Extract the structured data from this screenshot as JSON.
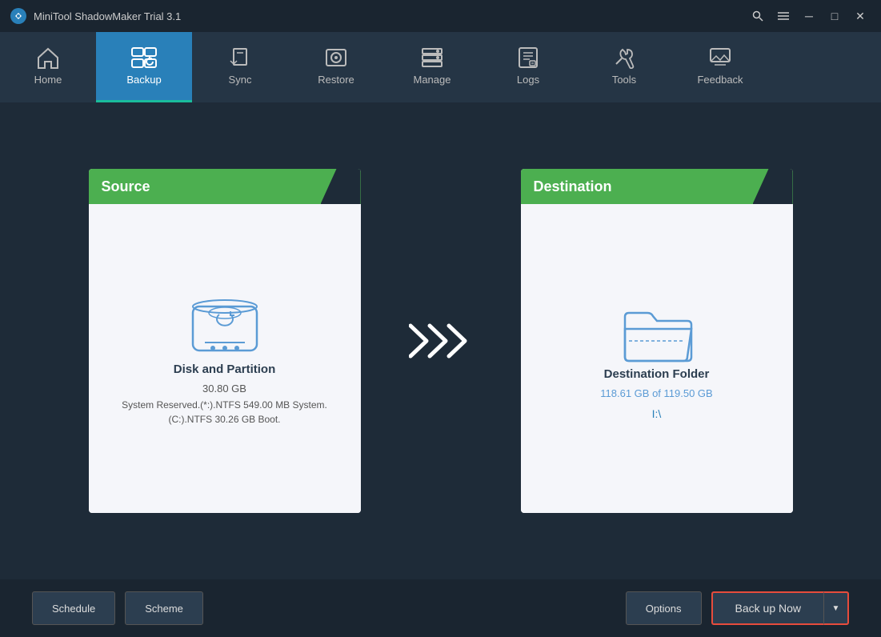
{
  "titleBar": {
    "title": "MiniTool ShadowMaker Trial 3.1",
    "controls": {
      "search": "🔍",
      "menu": "☰",
      "minimize": "─",
      "maximize": "□",
      "close": "✕"
    }
  },
  "nav": {
    "items": [
      {
        "id": "home",
        "label": "Home",
        "active": false
      },
      {
        "id": "backup",
        "label": "Backup",
        "active": true
      },
      {
        "id": "sync",
        "label": "Sync",
        "active": false
      },
      {
        "id": "restore",
        "label": "Restore",
        "active": false
      },
      {
        "id": "manage",
        "label": "Manage",
        "active": false
      },
      {
        "id": "logs",
        "label": "Logs",
        "active": false
      },
      {
        "id": "tools",
        "label": "Tools",
        "active": false
      },
      {
        "id": "feedback",
        "label": "Feedback",
        "active": false
      }
    ]
  },
  "source": {
    "header": "Source",
    "title": "Disk and Partition",
    "size": "30.80 GB",
    "details": "System Reserved.(*:).NTFS 549.00 MB System.\n(C:).NTFS 30.26 GB Boot."
  },
  "destination": {
    "header": "Destination",
    "title": "Destination Folder",
    "size": "118.61 GB of 119.50 GB",
    "path": "I:\\"
  },
  "bottomBar": {
    "schedule": "Schedule",
    "scheme": "Scheme",
    "options": "Options",
    "backupNow": "Back up Now",
    "dropdownArrow": "▼"
  }
}
